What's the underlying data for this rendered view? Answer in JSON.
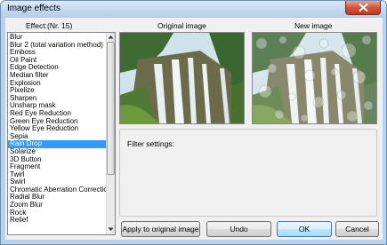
{
  "window": {
    "title": "Image effects"
  },
  "effects": {
    "label": "Effect:",
    "count": "(Nr. 15)",
    "items": [
      "Blur",
      "Blur 2 (total variation method)",
      "Emboss",
      "Oil Paint",
      "Edge Detection",
      "Median filter",
      "Explosion",
      "Pixelize",
      "Sharpen",
      "Unsharp mask",
      "Red Eye Reduction",
      "Green Eye Reduction",
      "Yellow Eye Reduction",
      "Sepia",
      "Rain Drop",
      "Solarize",
      "3D Button",
      "Fragment",
      "Twirl",
      "Swirl",
      "Chromatic Aberration Correction",
      "Radial Blur",
      "Zoom Blur",
      "Rock",
      "Relief"
    ],
    "selected": "Rain Drop"
  },
  "preview": {
    "original_label": "Original image",
    "new_label": "New image"
  },
  "filter": {
    "label": "Filter settings:"
  },
  "buttons": {
    "apply": "Apply to original image",
    "undo": "Undo",
    "ok": "OK",
    "cancel": "Cancel"
  },
  "icons": {
    "close": "close-icon",
    "scroll_up": "arrow-up-icon",
    "scroll_down": "arrow-down-icon"
  }
}
